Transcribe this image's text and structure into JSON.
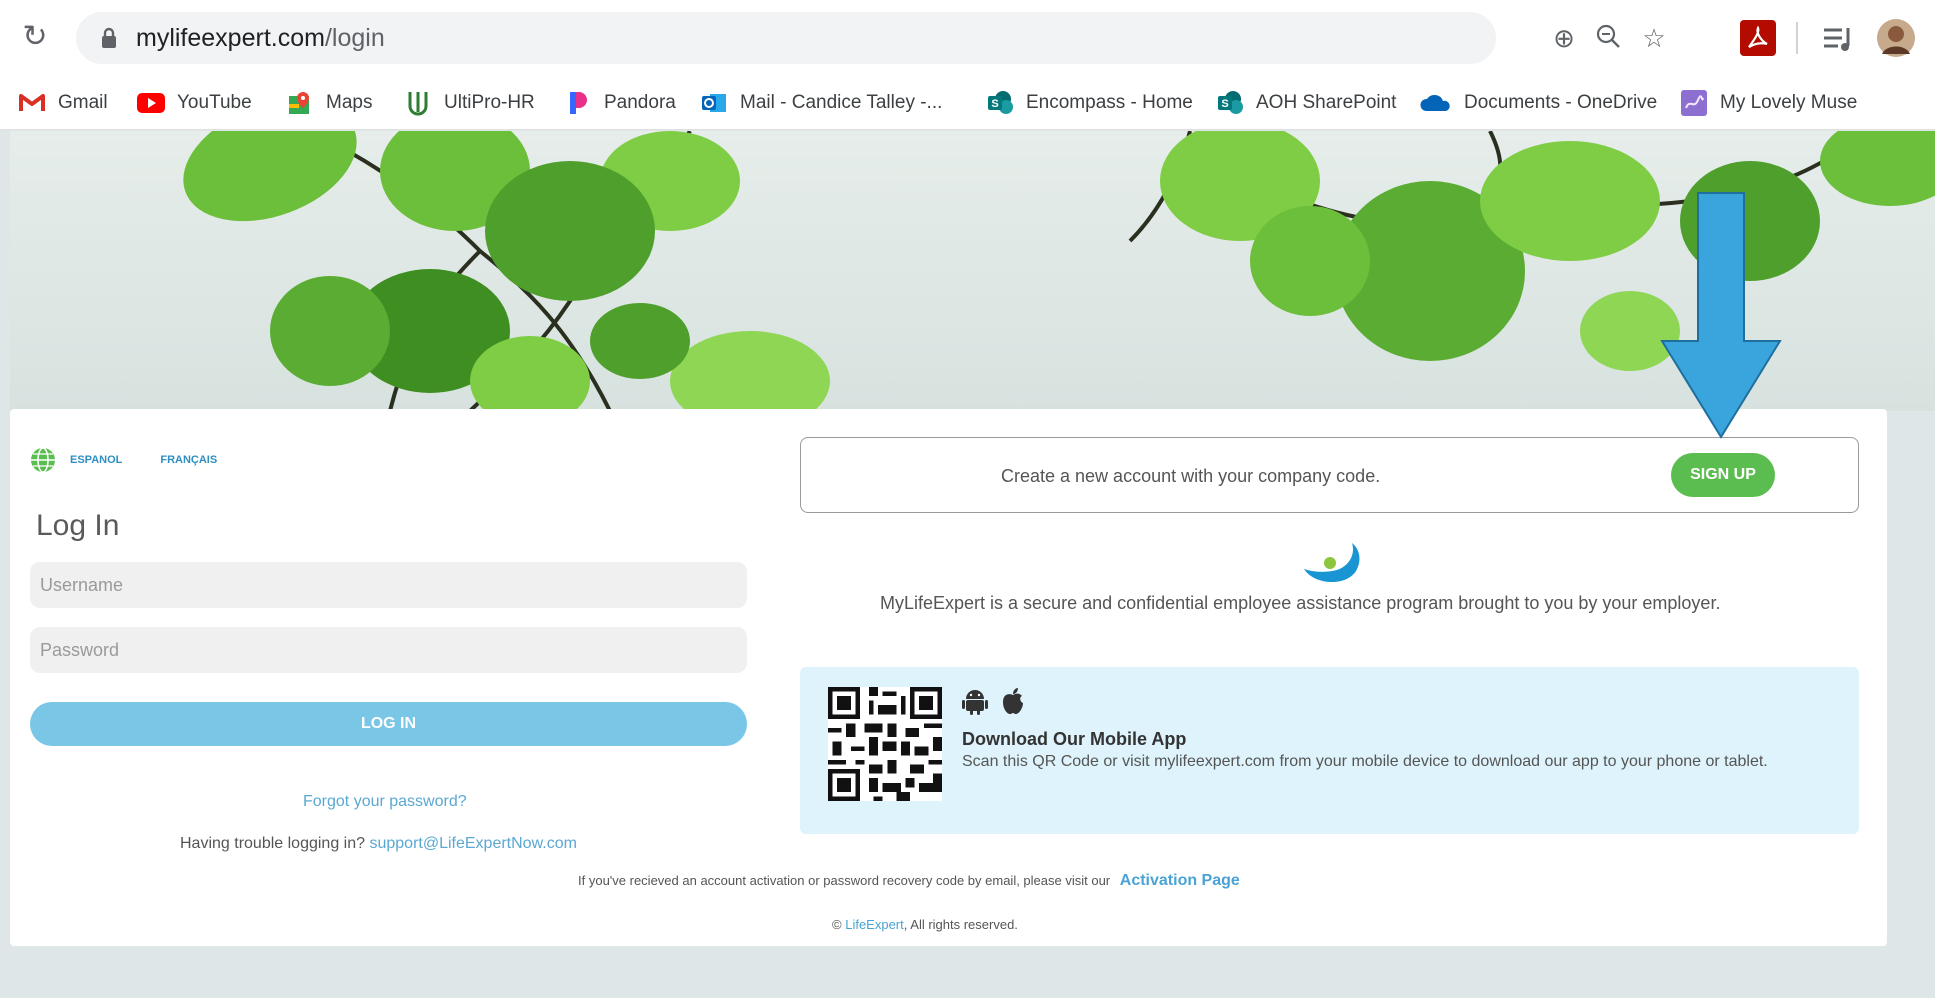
{
  "browser": {
    "url_host": "mylifeexpert.com",
    "url_path": "/login"
  },
  "bookmarks": [
    {
      "label": "Gmail",
      "icon": "gmail-icon"
    },
    {
      "label": "YouTube",
      "icon": "youtube-icon"
    },
    {
      "label": "Maps",
      "icon": "maps-icon"
    },
    {
      "label": "UltiPro-HR",
      "icon": "ultipro-icon"
    },
    {
      "label": "Pandora",
      "icon": "pandora-icon"
    },
    {
      "label": "Mail - Candice Talley -...",
      "icon": "outlook-icon"
    },
    {
      "label": "Encompass - Home",
      "icon": "sharepoint-icon"
    },
    {
      "label": "AOH SharePoint",
      "icon": "sharepoint-icon"
    },
    {
      "label": "Documents - OneDrive",
      "icon": "onedrive-icon"
    },
    {
      "label": "My Lovely Muse",
      "icon": "muse-icon"
    }
  ],
  "languages": [
    "ESPANOL",
    "FRANÇAIS"
  ],
  "login": {
    "title": "Log In",
    "username_placeholder": "Username",
    "password_placeholder": "Password",
    "button": "LOG IN",
    "forgot": "Forgot your password?",
    "trouble": "Having trouble logging in?",
    "support_email": "support@LifeExpertNow.com"
  },
  "signup": {
    "text": "Create a new account with your company code.",
    "button": "SIGN UP"
  },
  "tagline": "MyLifeExpert is a secure and confidential employee assistance program brought to you by your employer.",
  "app": {
    "title": "Download Our Mobile App",
    "description": "Scan this QR Code or visit mylifeexpert.com from your mobile device to download our app to your phone or tablet."
  },
  "footer": {
    "activation_text": "If you've recieved an account activation or password recovery code by email, please visit our",
    "activation_link": "Activation Page",
    "copyright_symbol": "©",
    "brand": "LifeExpert",
    "rights": ", All rights reserved."
  },
  "colors": {
    "login_button": "#79c6e7",
    "signup_button": "#5bbd4f",
    "link": "#4aa3d4",
    "app_box": "#def3fb",
    "annotation_arrow": "#3aa5dd"
  }
}
